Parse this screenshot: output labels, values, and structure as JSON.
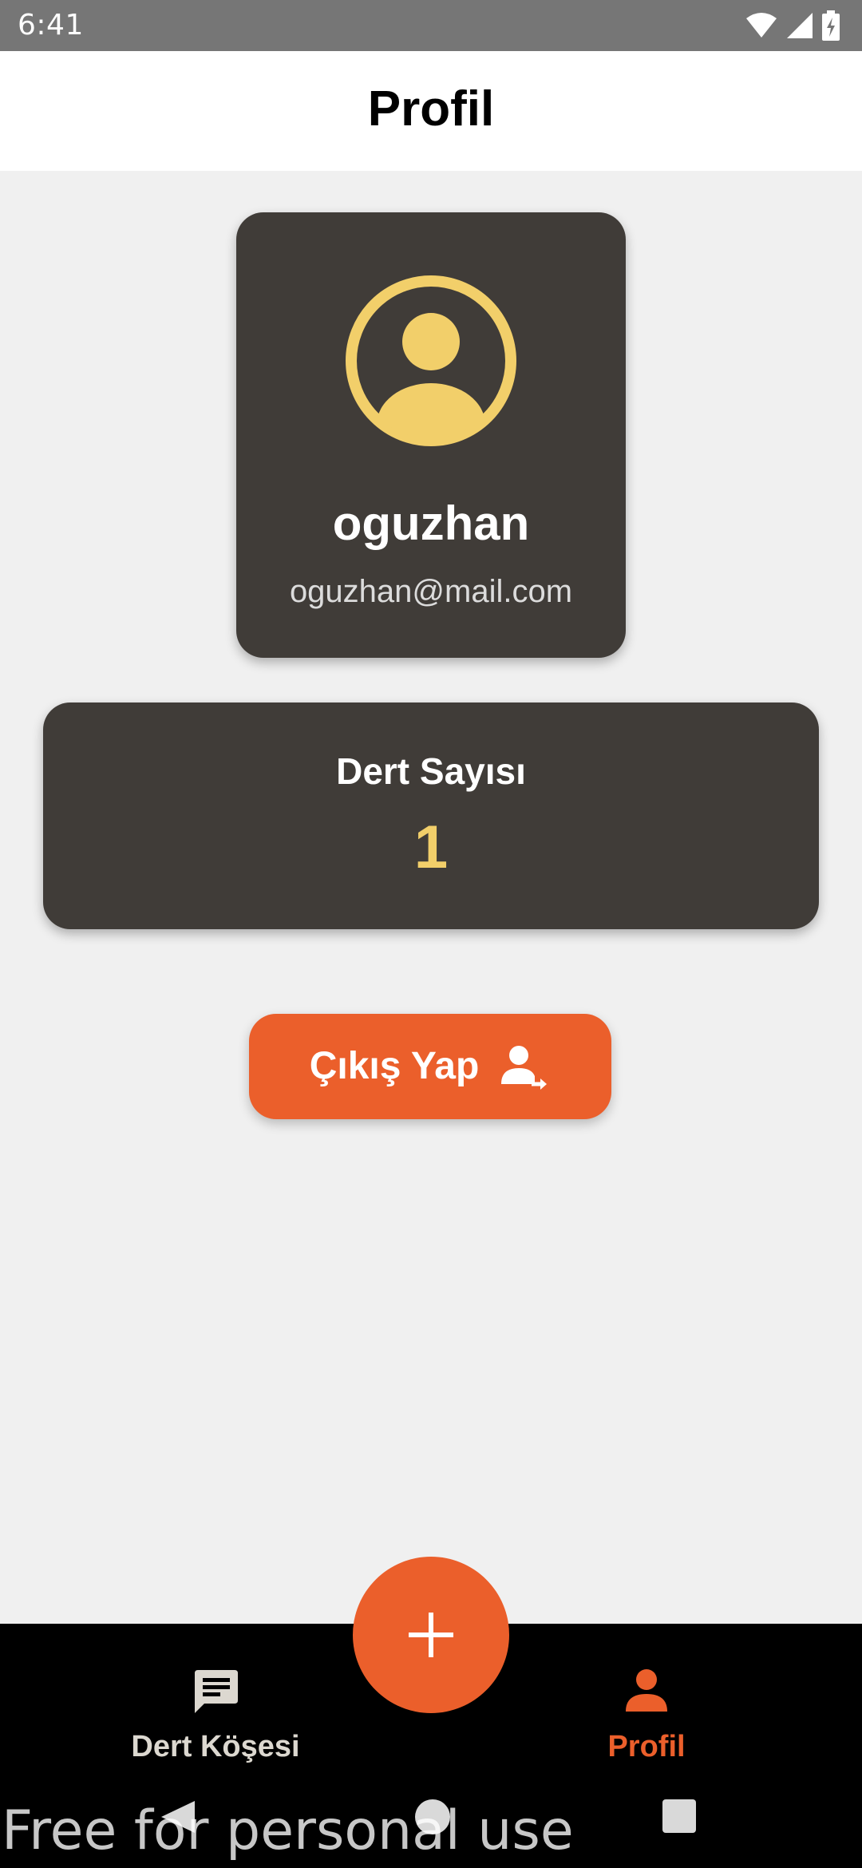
{
  "status_bar": {
    "time": "6:41",
    "icons": [
      "wifi-icon",
      "cellular-signal-icon",
      "battery-charging-icon"
    ]
  },
  "header": {
    "title": "Profil"
  },
  "profile": {
    "username": "oguzhan",
    "email": "oguzhan@mail.com",
    "avatar_icon": "user-circle-icon"
  },
  "stats": {
    "label": "Dert Sayısı",
    "value": "1"
  },
  "logout": {
    "label": "Çıkış Yap",
    "icon": "user-logout-icon"
  },
  "bottom_nav": {
    "items": [
      {
        "label": "Dert Köşesi",
        "icon": "chat-message-icon",
        "active": false
      },
      {
        "label": "Profil",
        "icon": "person-icon",
        "active": true
      }
    ],
    "fab_icon": "plus-icon"
  },
  "system_nav": {
    "icons": [
      "back-icon",
      "home-icon",
      "recents-icon"
    ]
  },
  "watermark": "Free for personal use",
  "colors": {
    "accent": "#eb5f2b",
    "card": "#403c38",
    "highlight": "#f2cf6a",
    "background": "#f0f0f0",
    "status_bar": "#767676"
  }
}
